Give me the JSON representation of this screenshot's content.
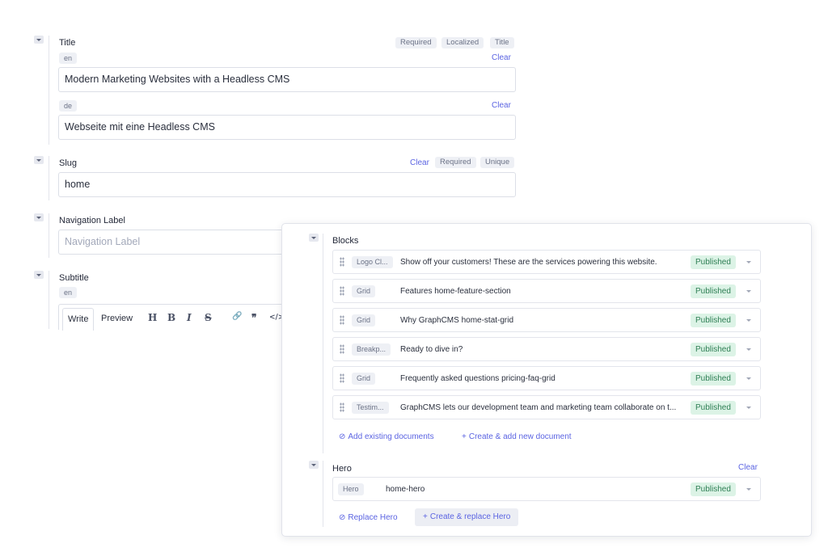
{
  "form": {
    "title_field": {
      "label": "Title",
      "badges": [
        "Required",
        "Localized",
        "Title"
      ],
      "locales": [
        {
          "code": "en",
          "clear": "Clear",
          "value": "Modern Marketing Websites with a Headless CMS"
        },
        {
          "code": "de",
          "clear": "Clear",
          "value": "Webseite mit eine Headless CMS"
        }
      ]
    },
    "slug_field": {
      "label": "Slug",
      "clear": "Clear",
      "badges": [
        "Required",
        "Unique"
      ],
      "value": "home"
    },
    "nav_label_field": {
      "label": "Navigation Label",
      "placeholder": "Navigation Label"
    },
    "subtitle_field": {
      "label": "Subtitle",
      "locale": "en",
      "tabs": [
        "Write",
        "Preview"
      ],
      "tools": [
        "H",
        "B",
        "I",
        "S",
        "🔗",
        "❞",
        "</>"
      ]
    }
  },
  "panel": {
    "blocks": {
      "label": "Blocks",
      "rows": [
        {
          "model": "Logo Cl...",
          "title": "Show off your customers! These are the services powering this website.",
          "status": "Published"
        },
        {
          "model": "Grid",
          "title": "Features home-feature-section",
          "status": "Published"
        },
        {
          "model": "Grid",
          "title": "Why GraphCMS home-stat-grid",
          "status": "Published"
        },
        {
          "model": "Breakp...",
          "title": "Ready to dive in?",
          "status": "Published"
        },
        {
          "model": "Grid",
          "title": "Frequently asked questions pricing-faq-grid",
          "status": "Published"
        },
        {
          "model": "Testim...",
          "title": "GraphCMS lets our development team and marketing team collaborate on t...",
          "status": "Published"
        }
      ],
      "add_existing": "Add existing documents",
      "create_new": "Create & add new document"
    },
    "hero": {
      "label": "Hero",
      "clear": "Clear",
      "row": {
        "model": "Hero",
        "title": "home-hero",
        "status": "Published"
      },
      "replace": "Replace Hero",
      "create_replace": "Create & replace Hero"
    }
  },
  "colors": {
    "accent": "#5b64e2",
    "published_bg": "#dcf3e6",
    "published_text": "#2f7f55"
  }
}
